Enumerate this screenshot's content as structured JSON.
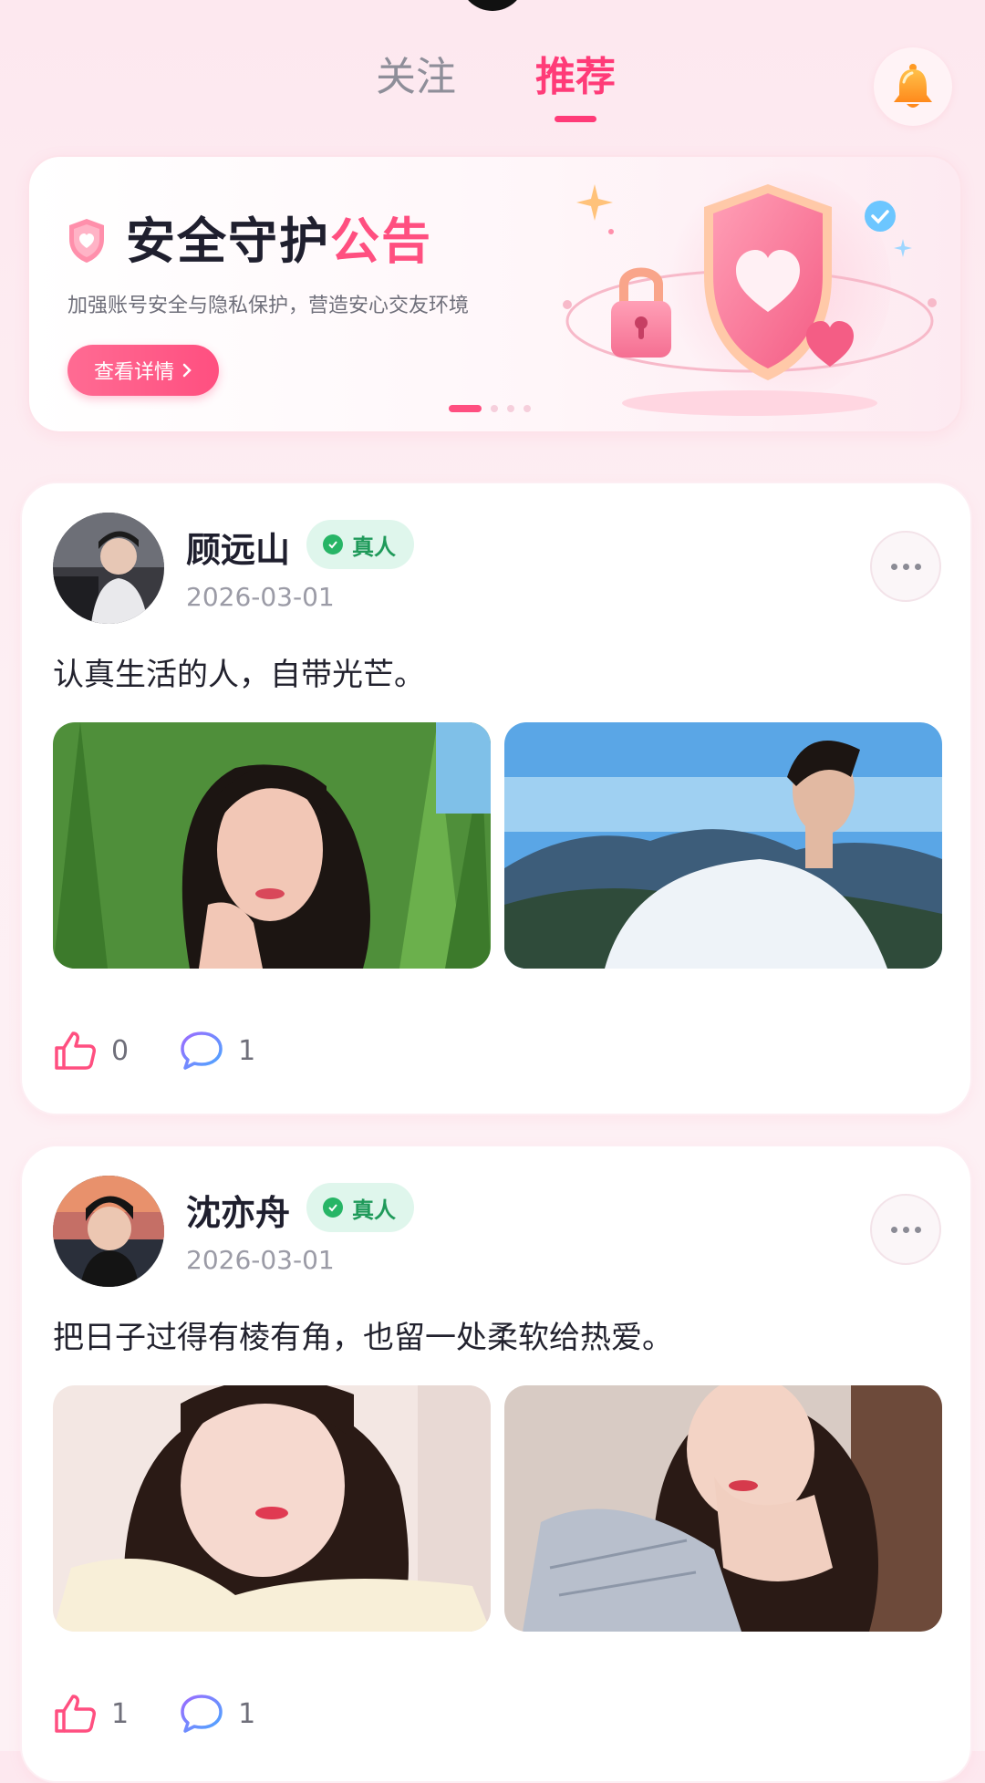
{
  "header": {
    "tabs": [
      {
        "label": "关注",
        "active": false
      },
      {
        "label": "推荐",
        "active": true
      }
    ],
    "bell_icon": "bell-icon"
  },
  "banner": {
    "title_main": "安全守护",
    "title_accent": "公告",
    "subtitle": "加强账号安全与隐私保护，营造安心交友环境",
    "button_label": "查看详情",
    "carousel_pages": 4,
    "carousel_active": 1
  },
  "posts": [
    {
      "name": "顾远山",
      "badge": "真人",
      "date": "2026-03-01",
      "content": "认真生活的人，自带光芒。",
      "likes": "0",
      "comments": "1"
    },
    {
      "name": "沈亦舟",
      "badge": "真人",
      "date": "2026-03-01",
      "content": "把日子过得有棱有角，也留一处柔软给热爱。",
      "likes": "1",
      "comments": "1"
    }
  ],
  "colors": {
    "accent": "#ff3b78",
    "badge_bg": "#dff6ec",
    "badge_text": "#1f9a5a"
  }
}
